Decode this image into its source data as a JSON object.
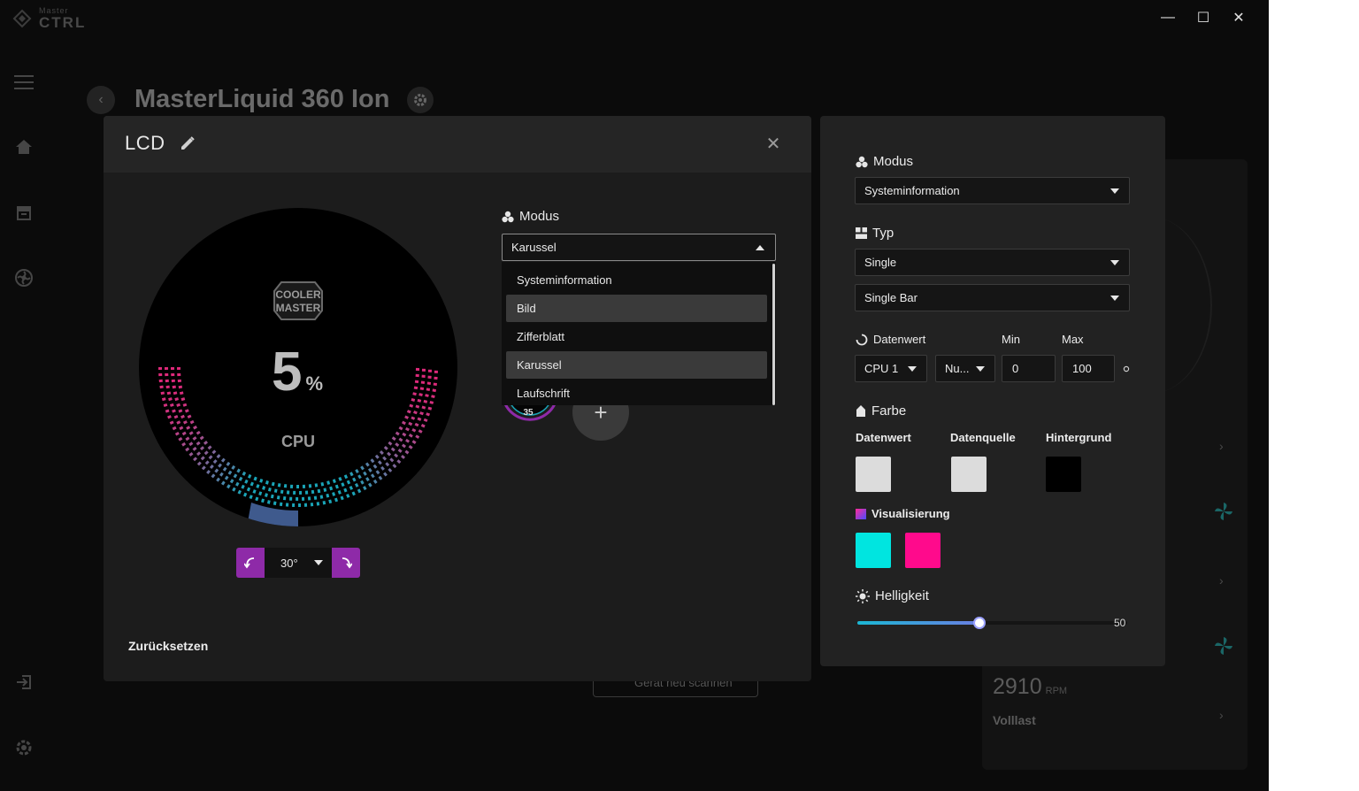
{
  "app": {
    "logo_small": "Master",
    "logo_big": "CTRL",
    "minimize": "—",
    "maximize": "☐",
    "close": "✕"
  },
  "background": {
    "device_title": "MasterLiquid 360 Ion",
    "rpm_value": "2910",
    "rpm_unit": "RPM",
    "mode": "Volllast",
    "rescan": "Gerät neu scannen"
  },
  "lcd": {
    "title": "LCD",
    "preview": {
      "value": "5",
      "unit": "%",
      "label": "CPU",
      "brand_line1": "COOLER",
      "brand_line2": "MASTER"
    },
    "rotation": "30°",
    "reset": "Zurücksetzen",
    "modus_label": "Modus",
    "modus_selected": "Karussel",
    "modus_options": [
      "Systeminformation",
      "Bild",
      "Zifferblatt",
      "Karussel",
      "Laufschrift"
    ],
    "thumb_value": "35",
    "add": "+"
  },
  "settings": {
    "modus_label": "Modus",
    "modus_value": "Systeminformation",
    "typ_label": "Typ",
    "typ_value": "Single",
    "typ_style": "Single Bar",
    "datenwert_label": "Datenwert",
    "min_label": "Min",
    "max_label": "Max",
    "datenwert_source": "CPU 1",
    "datenwert_type": "Nu...",
    "min_value": "0",
    "max_value": "100",
    "farbe_label": "Farbe",
    "col_datenwert": "Datenwert",
    "col_datenquelle": "Datenquelle",
    "col_hintergrund": "Hintergrund",
    "vis_label": "Visualisierung",
    "helligkeit_label": "Helligkeit",
    "helligkeit_value": "50",
    "brightness_fraction": 0.5,
    "colors": {
      "datenwert": "#dcdcdc",
      "datenquelle": "#dcdcdc",
      "hintergrund": "#000000",
      "vis1": "#00e5e0",
      "vis2": "#ff0a8c"
    }
  }
}
